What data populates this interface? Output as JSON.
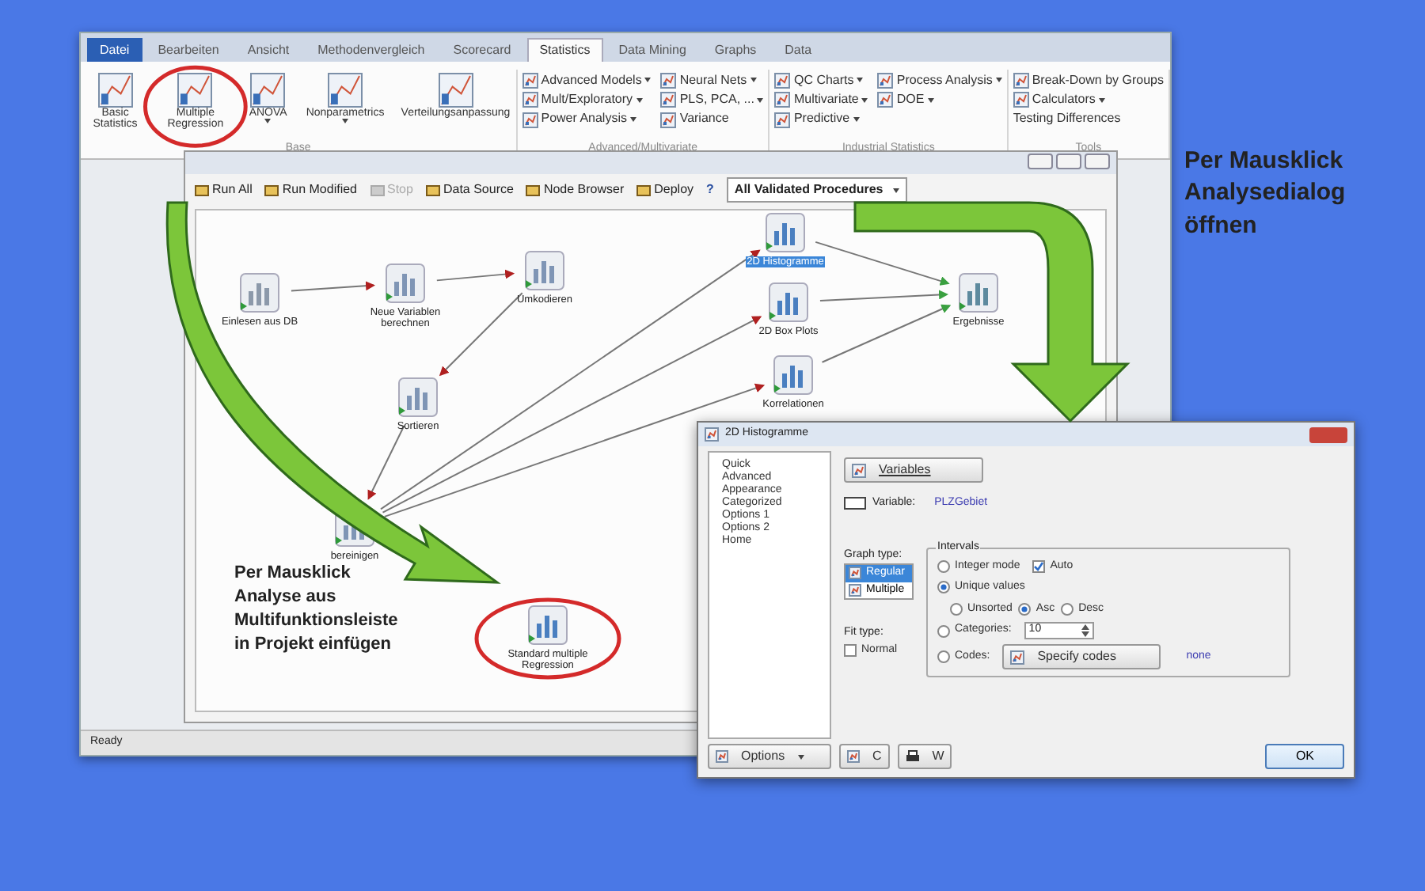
{
  "ribbon": {
    "tabs": [
      {
        "label": "Datei",
        "kind": "file",
        "selected": false
      },
      {
        "label": "Bearbeiten",
        "kind": "tab",
        "selected": false
      },
      {
        "label": "Ansicht",
        "kind": "tab",
        "selected": false
      },
      {
        "label": "Methodenvergleich",
        "kind": "tab",
        "selected": false
      },
      {
        "label": "Scorecard",
        "kind": "tab",
        "selected": false
      },
      {
        "label": "Statistics",
        "kind": "tab",
        "selected": true
      },
      {
        "label": "Data Mining",
        "kind": "tab",
        "selected": false
      },
      {
        "label": "Graphs",
        "kind": "tab",
        "selected": false
      },
      {
        "label": "Data",
        "kind": "tab",
        "selected": false
      }
    ],
    "groups": [
      {
        "title": "Base",
        "kind": "large",
        "items": [
          {
            "label": "Basic Statistics",
            "dropdown": false
          },
          {
            "label": "Multiple Regression",
            "dropdown": false
          },
          {
            "label": "ANOVA",
            "dropdown": true
          },
          {
            "label": "Nonparametrics",
            "dropdown": true
          },
          {
            "label": "Verteilungsanpassung",
            "dropdown": false
          }
        ]
      },
      {
        "title": "Advanced/Multivariate",
        "kind": "small",
        "items": [
          {
            "label": "Advanced Models",
            "dropdown": true,
            "icon": true
          },
          {
            "label": "Mult/Exploratory",
            "dropdown": true,
            "icon": true
          },
          {
            "label": "Power Analysis",
            "dropdown": true,
            "icon": true
          },
          {
            "label": "Neural Nets",
            "dropdown": true,
            "icon": true
          },
          {
            "label": "PLS, PCA, ...",
            "dropdown": true,
            "icon": true
          },
          {
            "label": "Variance",
            "dropdown": false,
            "icon": true
          }
        ]
      },
      {
        "title": "Industrial Statistics",
        "kind": "small",
        "items": [
          {
            "label": "QC Charts",
            "dropdown": true,
            "icon": true
          },
          {
            "label": "Multivariate",
            "dropdown": true,
            "icon": true
          },
          {
            "label": "Predictive",
            "dropdown": true,
            "icon": true
          },
          {
            "label": "Process Analysis",
            "dropdown": true,
            "icon": true
          },
          {
            "label": "DOE",
            "dropdown": true,
            "icon": true
          }
        ]
      },
      {
        "title": "Tools",
        "kind": "small",
        "items": [
          {
            "label": "Break-Down by Groups",
            "dropdown": false,
            "icon": true
          },
          {
            "label": "Calculators",
            "dropdown": true,
            "icon": true
          },
          {
            "label": "Testing Differences",
            "dropdown": false,
            "icon": false
          }
        ]
      }
    ]
  },
  "workflow": {
    "toolbar": [
      {
        "label": "Run All",
        "disabled": false
      },
      {
        "label": "Run Modified",
        "disabled": false
      },
      {
        "label": "Stop",
        "disabled": true
      },
      {
        "label": "Data Source",
        "disabled": false
      },
      {
        "label": "Node Browser",
        "disabled": false
      },
      {
        "label": "Deploy",
        "disabled": false
      }
    ],
    "help": "?",
    "procedure_select": "All Validated Procedures",
    "nodes": [
      {
        "label": "Einlesen aus DB",
        "kind": "data",
        "selected": false
      },
      {
        "label": "Neue Variablen berechnen",
        "kind": "transform",
        "selected": false
      },
      {
        "label": "Umkodieren",
        "kind": "transform",
        "selected": false
      },
      {
        "label": "Sortieren",
        "kind": "transform",
        "selected": false
      },
      {
        "label": "bereinigen",
        "kind": "transform",
        "selected": false
      },
      {
        "label": "Standard multiple Regression",
        "kind": "analysis",
        "selected": false
      },
      {
        "label": "2D Histogramme",
        "kind": "analysis",
        "selected": true
      },
      {
        "label": "2D Box Plots",
        "kind": "analysis",
        "selected": false
      },
      {
        "label": "Korrelationen",
        "kind": "analysis",
        "selected": false
      },
      {
        "label": "Ergebnisse",
        "kind": "result",
        "selected": false
      }
    ],
    "callout": "Per Mausklick\nAnalyse aus\nMultifunktionsleiste\nin Projekt  einfügen"
  },
  "status_bar": "Ready",
  "callout": "Per Mausklick\nAnalysedialog\nöffnen",
  "dialog": {
    "title": "2D Histogramme",
    "sections": [
      {
        "label": "Quick",
        "selected": false
      },
      {
        "label": "Advanced",
        "selected": false
      },
      {
        "label": "Appearance",
        "selected": false
      },
      {
        "label": "Categorized",
        "selected": false
      },
      {
        "label": "Options 1",
        "selected": false
      },
      {
        "label": "Options 2",
        "selected": false
      },
      {
        "label": "Home",
        "selected": false
      }
    ],
    "variables_button": "Variables",
    "variable_label": "Variable:",
    "variable_value": "PLZGebiet",
    "graph_type_label": "Graph type:",
    "graph_types": [
      {
        "label": "Regular",
        "selected": true
      },
      {
        "label": "Multiple",
        "selected": false
      }
    ],
    "fit_type_label": "Fit type:",
    "fit_normal": {
      "label": "Normal",
      "checked": false
    },
    "intervals": {
      "title": "Intervals",
      "integer_mode": {
        "label": "Integer mode",
        "selected": false
      },
      "auto": {
        "label": "Auto",
        "checked": true
      },
      "unique_values": {
        "label": "Unique values",
        "selected": true
      },
      "order": [
        {
          "label": "Unsorted",
          "selected": false
        },
        {
          "label": "Asc",
          "selected": true
        },
        {
          "label": "Desc",
          "selected": false
        }
      ],
      "categories": {
        "label": "Categories:",
        "selected": false,
        "value": "10"
      },
      "codes": {
        "label": "Codes:",
        "selected": false,
        "button": "Specify codes",
        "value": "none"
      }
    },
    "options_button": "Options",
    "c_button": "C",
    "w_button": "W",
    "ok_button": "OK"
  }
}
